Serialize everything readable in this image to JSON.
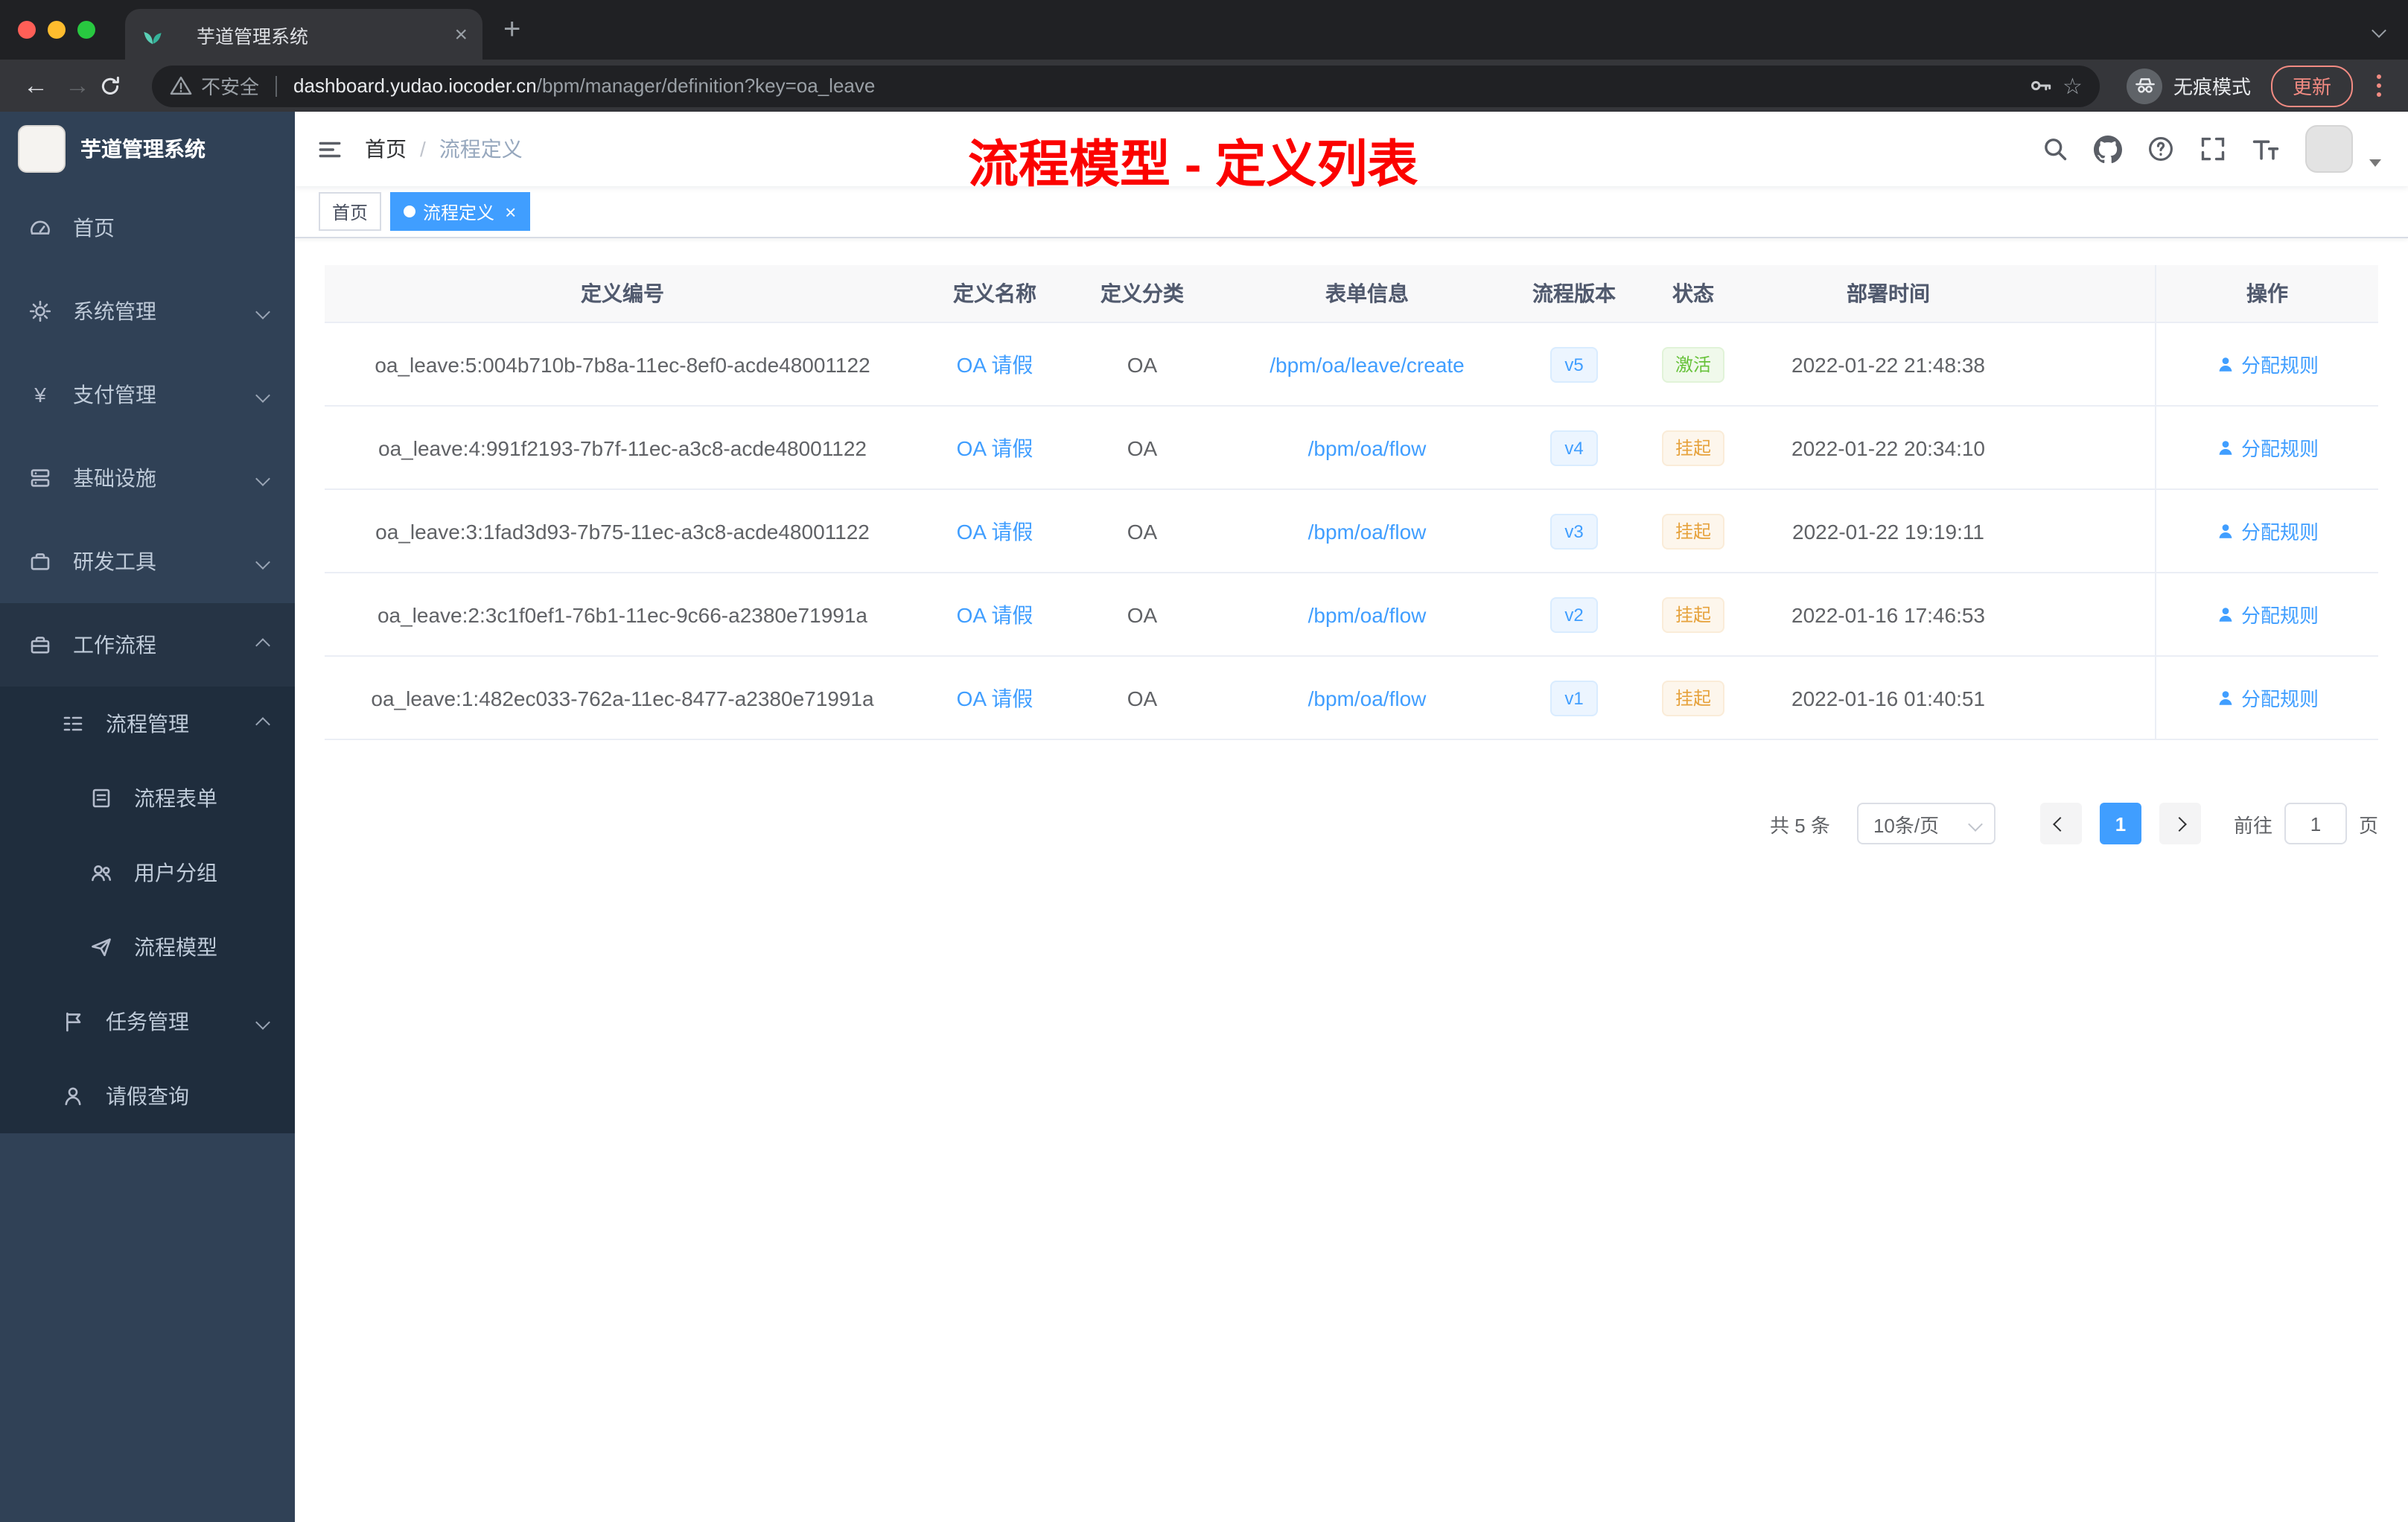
{
  "browser": {
    "tab_title": "芋道管理系统",
    "security_label": "不安全",
    "url_host": "dashboard.yudao.iocoder.cn",
    "url_path": "/bpm/manager/definition?key=oa_leave",
    "incognito_label": "无痕模式",
    "update_label": "更新"
  },
  "sidebar": {
    "logo_title": "芋道管理系统",
    "menu": [
      {
        "label": "首页"
      },
      {
        "label": "系统管理"
      },
      {
        "label": "支付管理"
      },
      {
        "label": "基础设施"
      },
      {
        "label": "研发工具"
      },
      {
        "label": "工作流程"
      }
    ],
    "submenu": {
      "process": {
        "label": "流程管理"
      },
      "process_children": [
        {
          "label": "流程表单"
        },
        {
          "label": "用户分组"
        },
        {
          "label": "流程模型"
        }
      ],
      "task": {
        "label": "任务管理"
      },
      "leave": {
        "label": "请假查询"
      }
    }
  },
  "navbar": {
    "breadcrumb_home": "首页",
    "breadcrumb_sep": "/",
    "breadcrumb_current": "流程定义"
  },
  "annotation": {
    "text": "流程模型 - 定义列表",
    "color": "#ff0000"
  },
  "tags": [
    {
      "label": "首页",
      "active": false
    },
    {
      "label": "流程定义",
      "active": true
    }
  ],
  "table": {
    "headers": [
      "定义编号",
      "定义名称",
      "定义分类",
      "表单信息",
      "流程版本",
      "状态",
      "部署时间",
      "操作"
    ],
    "rows": [
      {
        "id": "oa_leave:5:004b710b-7b8a-11ec-8ef0-acde48001122",
        "name": "OA 请假",
        "category": "OA",
        "form": "/bpm/oa/leave/create",
        "version": "v5",
        "status": "激活",
        "status_type": "success",
        "time": "2022-01-22 21:48:38",
        "action": "分配规则"
      },
      {
        "id": "oa_leave:4:991f2193-7b7f-11ec-a3c8-acde48001122",
        "name": "OA 请假",
        "category": "OA",
        "form": "/bpm/oa/flow",
        "version": "v4",
        "status": "挂起",
        "status_type": "warning",
        "time": "2022-01-22 20:34:10",
        "action": "分配规则"
      },
      {
        "id": "oa_leave:3:1fad3d93-7b75-11ec-a3c8-acde48001122",
        "name": "OA 请假",
        "category": "OA",
        "form": "/bpm/oa/flow",
        "version": "v3",
        "status": "挂起",
        "status_type": "warning",
        "time": "2022-01-22 19:19:11",
        "action": "分配规则"
      },
      {
        "id": "oa_leave:2:3c1f0ef1-76b1-11ec-9c66-a2380e71991a",
        "name": "OA 请假",
        "category": "OA",
        "form": "/bpm/oa/flow",
        "version": "v2",
        "status": "挂起",
        "status_type": "warning",
        "time": "2022-01-16 17:46:53",
        "action": "分配规则"
      },
      {
        "id": "oa_leave:1:482ec033-762a-11ec-8477-a2380e71991a",
        "name": "OA 请假",
        "category": "OA",
        "form": "/bpm/oa/flow",
        "version": "v1",
        "status": "挂起",
        "status_type": "warning",
        "time": "2022-01-16 01:40:51",
        "action": "分配规则"
      }
    ]
  },
  "pagination": {
    "total": "共 5 条",
    "page_size": "10条/页",
    "current_page": "1",
    "goto_label": "前往",
    "goto_value": "1",
    "unit_label": "页"
  },
  "colors": {
    "primary": "#409eff",
    "success": "#67c23a",
    "warning": "#e6a23c",
    "sidebar_bg": "#304156",
    "submenu_bg": "#1f2d3d",
    "annotation_red": "#ff0000"
  }
}
